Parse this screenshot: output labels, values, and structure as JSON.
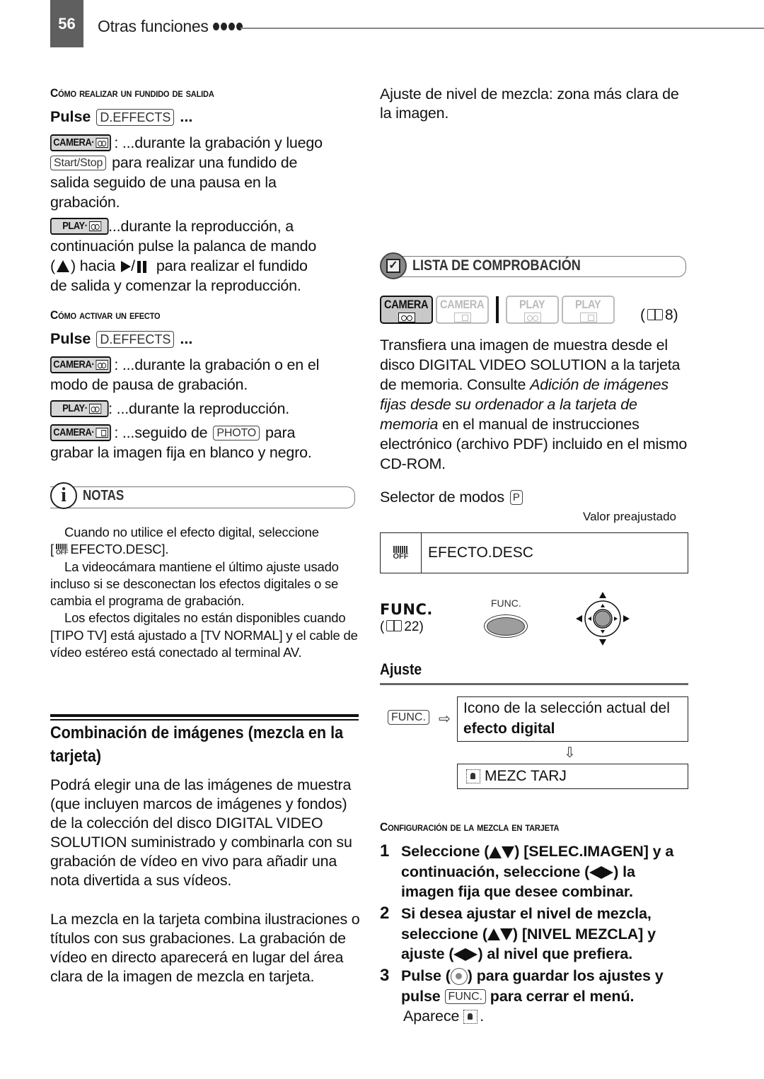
{
  "header": {
    "page_number": "56",
    "section_title": "Otras funciones"
  },
  "left": {
    "fade": {
      "heading": "Cómo realizar un fundido de salida",
      "pulse_label": "Pulse",
      "key": "D.EFFECTS",
      "ellipsis": "...",
      "camera_tape_mode": "CAMERA·",
      "camera_text": ": ...durante la grabación y luego",
      "start_stop_key": "Start/Stop",
      "camera_text_2": "para realizar una fundido de",
      "camera_text_3": "salida seguido de una pausa en la",
      "camera_text_4": "grabación.",
      "play_tape_mode": "PLAY·",
      "play_text_1": "...durante la reproducción, a",
      "play_text_2": "continuación pulse la palanca de mando",
      "play_text_3a": "(",
      "play_text_3b": ") hacia",
      "play_text_3c": "para realizar el fundido",
      "play_text_4": "de salida y comenzar la reproducción."
    },
    "effect": {
      "heading": "Cómo activar un efecto",
      "pulse_label": "Pulse",
      "key": "D.EFFECTS",
      "ellipsis": "...",
      "camera_tape_mode": "CAMERA·",
      "camera_text_1": ": ...durante la grabación o en el",
      "camera_text_2": "modo de pausa de grabación.",
      "play_tape_mode": "PLAY·",
      "play_text": ": ...durante la reproducción.",
      "camera_card_mode": "CAMERA·",
      "card_text_1": ": ...seguido de",
      "photo_key": "PHOTO",
      "card_text_2": "para",
      "card_text_3": "grabar la imagen fija en blanco y negro."
    },
    "notes": {
      "title": "NOTAS",
      "items": [
        {
          "line1": "Cuando no utilice el efecto digital, seleccione",
          "line2_prefix": "[",
          "line2": "EFFECTO.DESC].",
          "icon": "effect-off-icon"
        },
        {
          "text": "La videocámara mantiene el último ajuste usado incluso si se desconectan los efectos digitales o se cambia el programa de grabación."
        },
        {
          "text": "Los efectos digitales no están disponibles cuando [TIPO TV] está ajustado a [TV NORMAL] y el cable de vídeo estéreo está conectado al terminal AV."
        }
      ]
    },
    "card_mix": {
      "title": "Combinación de imágenes (mezcla en la tarjeta)",
      "para1": "Podrá elegir una de las imágenes de muestra (que incluyen marcos de imágenes y fondos) de la colección del disco DIGITAL VIDEO SOLUTION suministrado y combinarla con su grabación de vídeo en vivo para añadir una nota divertida a sus vídeos.",
      "para2": "La mezcla en la tarjeta combina ilustraciones o títulos con sus grabaciones. La grabación de vídeo en directo aparecerá en lugar del área clara de la imagen de mezcla en tarjeta."
    }
  },
  "right": {
    "mix_level_note": "Ajuste de nivel de mezcla: zona más clara de la imagen.",
    "checklist": {
      "title": "LISTA DE COMPROBACIÓN",
      "modes": [
        {
          "label": "CAMERA",
          "media": "tape",
          "active": true
        },
        {
          "label": "CAMERA",
          "media": "card",
          "active": false
        },
        {
          "label": "PLAY",
          "media": "tape",
          "active": false
        },
        {
          "label": "PLAY",
          "media": "card",
          "active": false
        }
      ],
      "ref_open": "(",
      "ref_page": "8)"
    },
    "transfer": {
      "text_normal_1": "Transfiera una imagen de muestra desde el disco DIGITAL VIDEO SOLUTION a la tarjeta de memoria. Consulte ",
      "text_italic": "Adición de imágenes fijas desde su ordenador a la tarjeta de memoria",
      "text_normal_2": " en el manual de instrucciones electrónico (archivo PDF) incluido en el mismo CD-ROM."
    },
    "mode_selector": {
      "label": "Selector de modos",
      "mode_key": "P",
      "preset_label": "Valor preajustado"
    },
    "preset_box": {
      "icon": "effect-off-icon",
      "value": "EFECTO.DESC"
    },
    "func": {
      "label": "FUNC.",
      "ref_open": "(",
      "ref_page": "22)",
      "button_caption": "FUNC."
    },
    "ajuste": {
      "heading": "Ajuste",
      "func_key": "FUNC.",
      "box1_normal": "Icono de la selección actual del ",
      "box1_bold": "efecto digital",
      "box2_value": "MEZC TARJ"
    },
    "config": {
      "heading": "Configuración de la mezcla en tarjeta",
      "steps": [
        {
          "num": "1",
          "a": "Seleccione (",
          "b": ") [SELEC.IMAGEN] y a continuación, seleccione (",
          "c": ") la imagen fija que desee combinar."
        },
        {
          "num": "2",
          "a": "Si desea ajustar el nivel de mezcla, seleccione (",
          "b": ") [NIVEL MEZCLA] y ajuste (",
          "c": ") al nivel que prefiera."
        },
        {
          "num": "3",
          "a": "Pulse (",
          "b": ") para guardar los ajustes y pulse",
          "func_key": "FUNC.",
          "c": "para cerrar el menú.",
          "appear": "Aparece",
          "appear_end": "."
        }
      ]
    }
  }
}
